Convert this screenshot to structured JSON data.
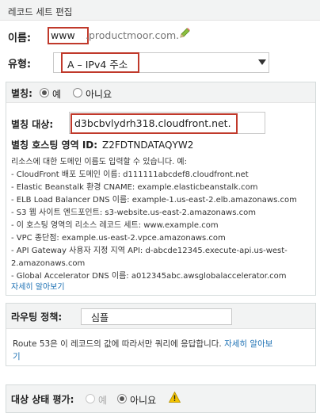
{
  "header": {
    "title": "레코드 세트 편집"
  },
  "name": {
    "label": "이름:",
    "value": "www",
    "suffix": ".productmoor.com."
  },
  "type": {
    "label": "유형:",
    "value": "A – IPv4 주소"
  },
  "alias": {
    "label": "별칭:",
    "yes_label": "예",
    "no_label": "아니요",
    "selected": "yes",
    "target_label": "별칭 대상:",
    "target_value": "d3bcbvlydrh318.cloudfront.net.",
    "zone_label": "별칭 호스팅 영역 ID:",
    "zone_value": "Z2FDTNDATAQYW2",
    "help_lines": [
      "리소스에 대한 도메인 이름도 입력할 수 있습니다. 예:",
      "- CloudFront 배포 도메인 이름: d111111abcdef8.cloudfront.net",
      "- Elastic Beanstalk 환경 CNAME: example.elasticbeanstalk.com",
      "- ELB Load Balancer DNS 이름: example-1.us-east-2.elb.amazonaws.com",
      "- S3 웹 사이트 엔드포인트: s3-website.us-east-2.amazonaws.com",
      "- 이 호스팅 영역의 리소스 레코드 세트: www.example.com",
      "- VPC 종단점: example.us-east-2.vpce.amazonaws.com",
      "- API Gateway 사용자 지정 지역 API: d-abcde12345.execute-api.us-west-",
      "2.amazonaws.com",
      "- Global Accelerator DNS 이름: a012345abc.awsglobalaccelerator.com"
    ],
    "learn_more": "자세히 알아보기"
  },
  "routing": {
    "label": "라우팅 정책:",
    "value": "심플",
    "description": "Route 53은 이 레코드의 값에 따라서만 쿼리에 응답합니다.",
    "learn_more_1": "자세히 알아보",
    "learn_more_2": "기"
  },
  "health": {
    "label": "대상 상태 평가:",
    "yes_label": "예",
    "no_label": "아니요",
    "selected": "no"
  },
  "colors": {
    "highlight": "#c0392b",
    "link": "#1a6fb3",
    "panel_bg": "#f2f3f3"
  }
}
